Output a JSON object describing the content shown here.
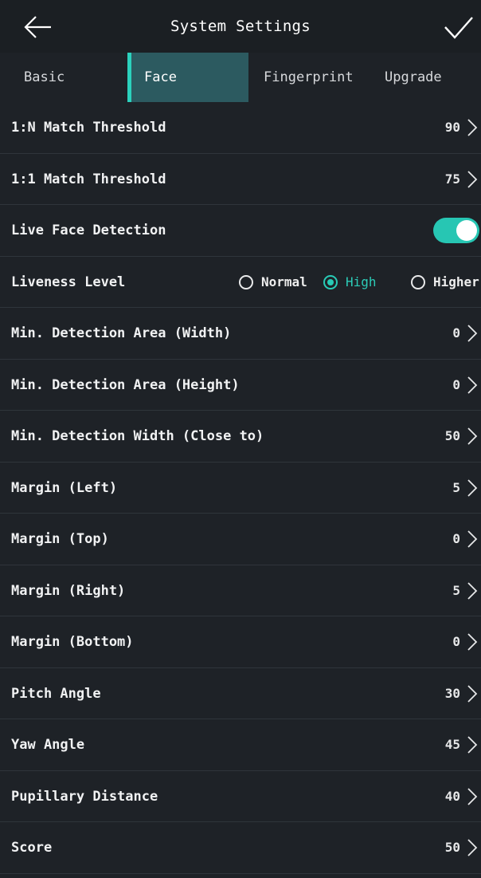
{
  "header": {
    "title": "System Settings",
    "back_icon": "arrow-left-icon",
    "confirm_icon": "checkmark-icon"
  },
  "tabs": [
    {
      "label": "Basic"
    },
    {
      "label": "Face"
    },
    {
      "label": "Fingerprint"
    },
    {
      "label": "Upgrade"
    }
  ],
  "active_tab": "Face",
  "colors": {
    "background": "#1e2227",
    "accent": "#2bd1bd",
    "active_tab_bg": "#2c5a60",
    "divider": "#2f353b"
  },
  "rows": {
    "match_1n": {
      "label": "1:N Match Threshold",
      "value": "90"
    },
    "match_11": {
      "label": "1:1 Match Threshold",
      "value": "75"
    },
    "live_face": {
      "label": "Live Face Detection",
      "enabled": true
    },
    "liveness": {
      "label": "Liveness Level",
      "options": [
        "Normal",
        "High",
        "Higher"
      ],
      "selected": "High"
    },
    "min_area_width": {
      "label": "Min. Detection Area (Width)",
      "value": "0"
    },
    "min_area_height": {
      "label": "Min. Detection Area (Height)",
      "value": "0"
    },
    "min_width_close": {
      "label": "Min. Detection Width (Close to)",
      "value": "50"
    },
    "margin_left": {
      "label": "Margin (Left)",
      "value": "5"
    },
    "margin_top": {
      "label": "Margin (Top)",
      "value": "0"
    },
    "margin_right": {
      "label": "Margin (Right)",
      "value": "5"
    },
    "margin_bottom": {
      "label": "Margin (Bottom)",
      "value": "0"
    },
    "pitch_angle": {
      "label": "Pitch Angle",
      "value": "30"
    },
    "yaw_angle": {
      "label": "Yaw Angle",
      "value": "45"
    },
    "pupillary_distance": {
      "label": "Pupillary Distance",
      "value": "40"
    },
    "score": {
      "label": "Score",
      "value": "50"
    }
  }
}
